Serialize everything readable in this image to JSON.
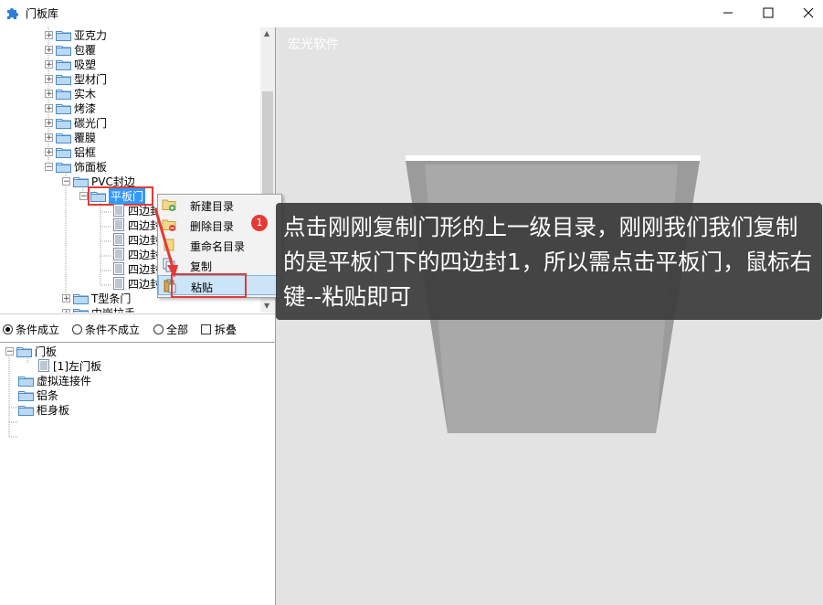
{
  "window": {
    "title": "门板库",
    "minimize_icon": "minimize-icon",
    "maximize_icon": "maximize-icon",
    "close_icon": "close-icon"
  },
  "tree": {
    "items": [
      {
        "label": "亚克力"
      },
      {
        "label": "包覆"
      },
      {
        "label": "吸塑"
      },
      {
        "label": "型材门"
      },
      {
        "label": "实木"
      },
      {
        "label": "烤漆"
      },
      {
        "label": "碳光门"
      },
      {
        "label": "覆膜"
      },
      {
        "label": "铝框"
      },
      {
        "label": "饰面板"
      },
      {
        "label": "PVC封边"
      },
      {
        "label": "平板门"
      },
      {
        "label": "四边封"
      },
      {
        "label": "四边封"
      },
      {
        "label": "四边封"
      },
      {
        "label": "四边封"
      },
      {
        "label": "四边封"
      },
      {
        "label": "四边封"
      },
      {
        "label": "T型条门"
      },
      {
        "label": "内嵌拉手"
      }
    ]
  },
  "conditions": {
    "opt1": "条件成立",
    "opt2": "条件不成立",
    "opt3": "全部",
    "fold": "拆叠"
  },
  "tree2": {
    "items": [
      {
        "label": "门板"
      },
      {
        "label": "[1]左门板"
      },
      {
        "label": "虚拟连接件"
      },
      {
        "label": "铝条"
      },
      {
        "label": "柜身板"
      }
    ]
  },
  "preview": {
    "brand": "宏光软件"
  },
  "context_menu": {
    "items": [
      {
        "label": "新建目录"
      },
      {
        "label": "删除目录"
      },
      {
        "label": "重命名目录"
      },
      {
        "label": "复制"
      },
      {
        "label": "粘贴"
      }
    ]
  },
  "annotation": {
    "badge": "1",
    "text": "点击刚刚复制门形的上一级目录，刚刚我们我们复制的是平板门下的四边封1，所以需点击平板门，鼠标右键--粘贴即可"
  },
  "colors": {
    "accent": "#e53935",
    "selection": "#3399ff",
    "door_front": "#a8a8a8",
    "door_back": "#9a9a9a",
    "panel_bg": "#e3e3e3"
  }
}
